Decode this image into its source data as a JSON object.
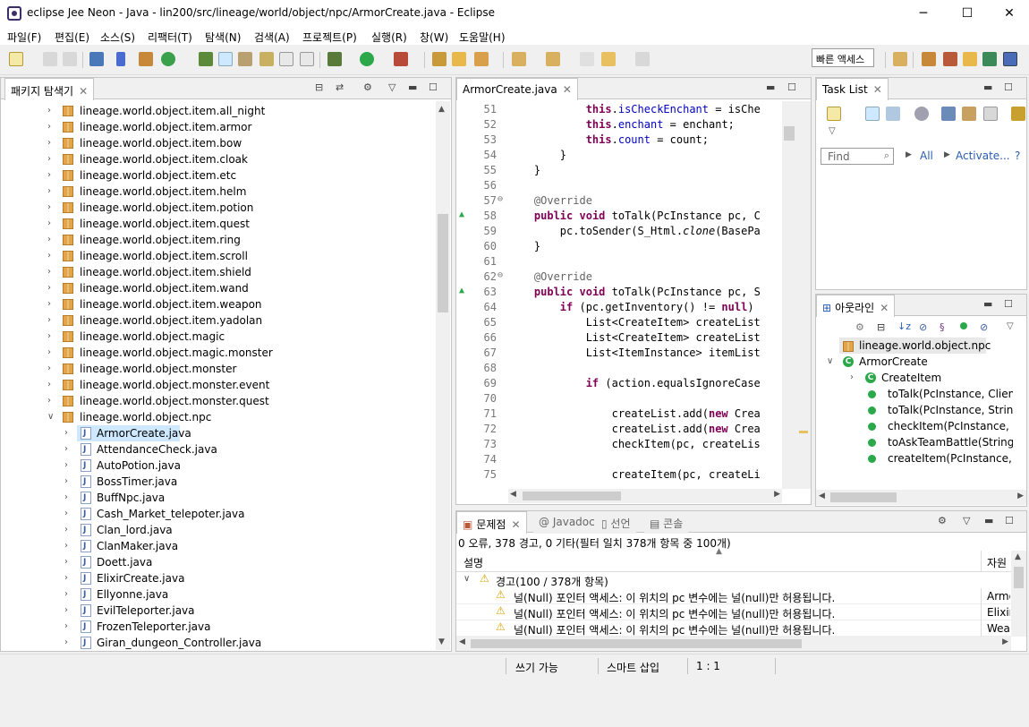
{
  "window": {
    "title": "eclipse Jee Neon - Java - lin200/src/lineage/world/object/npc/ArmorCreate.java - Eclipse",
    "minimize": "─",
    "maximize": "☐",
    "close": "✕"
  },
  "menu": [
    "파일(F)",
    "편집(E)",
    "소스(S)",
    "리팩터(T)",
    "탐색(N)",
    "검색(A)",
    "프로젝트(P)",
    "실행(R)",
    "창(W)",
    "도움말(H)"
  ],
  "quick_access": "빠른 액세스",
  "package_explorer": {
    "tab": "패키지 탐색기",
    "packages": [
      "lineage.world.object.item.all_night",
      "lineage.world.object.item.armor",
      "lineage.world.object.item.bow",
      "lineage.world.object.item.cloak",
      "lineage.world.object.item.etc",
      "lineage.world.object.item.helm",
      "lineage.world.object.item.potion",
      "lineage.world.object.item.quest",
      "lineage.world.object.item.ring",
      "lineage.world.object.item.scroll",
      "lineage.world.object.item.shield",
      "lineage.world.object.item.wand",
      "lineage.world.object.item.weapon",
      "lineage.world.object.item.yadolan",
      "lineage.world.object.magic",
      "lineage.world.object.magic.monster",
      "lineage.world.object.monster",
      "lineage.world.object.monster.event",
      "lineage.world.object.monster.quest",
      "lineage.world.object.npc"
    ],
    "files": [
      "ArmorCreate.java",
      "AttendanceCheck.java",
      "AutoPotion.java",
      "BossTimer.java",
      "BuffNpc.java",
      "Cash_Market_telepoter.java",
      "Clan_lord.java",
      "ClanMaker.java",
      "Doett.java",
      "ElixirCreate.java",
      "Ellyonne.java",
      "EvilTeleporter.java",
      "FrozenTeleporter.java",
      "Giran_dungeon_Controller.java"
    ]
  },
  "editor": {
    "tab": "ArmorCreate.java",
    "lines": [
      {
        "n": "51",
        "html": "            <span class='kw'>this</span>.<span class='fld'>isCheckEnchant</span> = isChe"
      },
      {
        "n": "52",
        "html": "            <span class='kw'>this</span>.<span class='fld'>enchant</span> = enchant;"
      },
      {
        "n": "53",
        "html": "            <span class='kw'>this</span>.<span class='fld'>count</span> = count;"
      },
      {
        "n": "54",
        "html": "        }"
      },
      {
        "n": "55",
        "html": "    }"
      },
      {
        "n": "56",
        "html": ""
      },
      {
        "n": "57",
        "html": "    <span class='ann'>@Override</span>"
      },
      {
        "n": "58",
        "html": "    <span class='kw'>public</span> <span class='kw'>void</span> toTalk(PcInstance pc, C"
      },
      {
        "n": "59",
        "html": "        pc.toSender(S_Html.<span class='it'>clone</span>(BasePa"
      },
      {
        "n": "60",
        "html": "    }"
      },
      {
        "n": "61",
        "html": ""
      },
      {
        "n": "62",
        "html": "    <span class='ann'>@Override</span>"
      },
      {
        "n": "63",
        "html": "    <span class='kw'>public</span> <span class='kw'>void</span> toTalk(PcInstance pc, S"
      },
      {
        "n": "64",
        "html": "        <span class='kw'>if</span> (pc.getInventory() != <span class='kw'>null</span>)"
      },
      {
        "n": "65",
        "html": "            List&lt;CreateItem&gt; createList"
      },
      {
        "n": "66",
        "html": "            List&lt;CreateItem&gt; createList"
      },
      {
        "n": "67",
        "html": "            List&lt;ItemInstance&gt; itemList"
      },
      {
        "n": "68",
        "html": ""
      },
      {
        "n": "69",
        "html": "            <span class='kw'>if</span> (action.equalsIgnoreCase"
      },
      {
        "n": "70",
        "html": ""
      },
      {
        "n": "71",
        "html": "                createList.add(<span class='kw'>new</span> Crea"
      },
      {
        "n": "72",
        "html": "                createList.add(<span class='kw'>new</span> Crea"
      },
      {
        "n": "73",
        "html": "                checkItem(pc, createLis"
      },
      {
        "n": "74",
        "html": ""
      },
      {
        "n": "75",
        "html": "                createItem(pc, createLi"
      }
    ]
  },
  "tasklist": {
    "tab": "Task List",
    "find_placeholder": "Find",
    "all": "All",
    "activate": "Activate..."
  },
  "outline": {
    "tab": "아웃라인",
    "items": [
      "lineage.world.object.npc",
      "ArmorCreate",
      "CreateItem",
      "toTalk(PcInstance, ClientBase",
      "toTalk(PcInstance, String, St",
      "checkItem(PcInstance, List<C",
      "toAskTeamBattle(String) : vo",
      "createItem(PcInstance, List<"
    ]
  },
  "problems": {
    "tabs": [
      "문제점",
      "Javadoc",
      "선언",
      "콘솔"
    ],
    "summary": "0 오류, 378 경고, 0 기타(필터 일치 378개 항목 중 100개)",
    "col_desc": "설명",
    "col_res": "자원",
    "group": "경고(100 / 378개 항목)",
    "rows": [
      {
        "msg": "널(Null) 포인터 액세스: 이 위치의 pc 변수에는 널(null)만 허용됩니다.",
        "res": "Armo"
      },
      {
        "msg": "널(Null) 포인터 액세스: 이 위치의 pc 변수에는 널(null)만 허용됩니다.",
        "res": "Elixir"
      },
      {
        "msg": "널(Null) 포인터 액세스: 이 위치의 pc 변수에는 널(null)만 허용됩니다.",
        "res": "Weap"
      }
    ]
  },
  "status": {
    "write": "쓰기 가능",
    "insert": "스마트 삽입",
    "pos": "1 : 1"
  }
}
